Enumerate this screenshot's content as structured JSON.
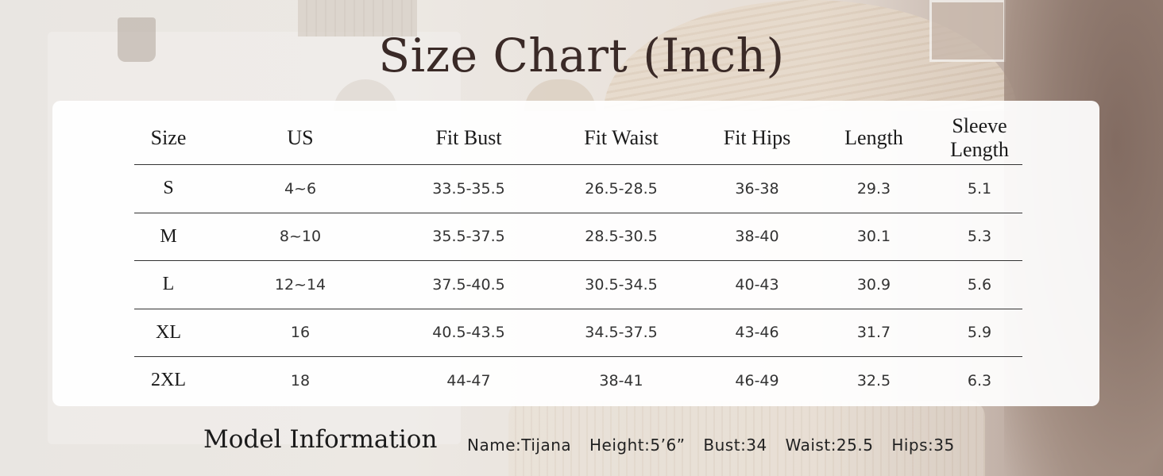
{
  "title": "Size Chart (Inch)",
  "table": {
    "headers": [
      "Size",
      "US",
      "Fit Bust",
      "Fit Waist",
      "Fit Hips",
      "Length",
      "Sleeve Length"
    ],
    "rows": [
      [
        "S",
        "4~6",
        "33.5-35.5",
        "26.5-28.5",
        "36-38",
        "29.3",
        "5.1"
      ],
      [
        "M",
        "8~10",
        "35.5-37.5",
        "28.5-30.5",
        "38-40",
        "30.1",
        "5.3"
      ],
      [
        "L",
        "12~14",
        "37.5-40.5",
        "30.5-34.5",
        "40-43",
        "30.9",
        "5.6"
      ],
      [
        "XL",
        "16",
        "40.5-43.5",
        "34.5-37.5",
        "43-46",
        "31.7",
        "5.9"
      ],
      [
        "2XL",
        "18",
        "44-47",
        "38-41",
        "46-49",
        "32.5",
        "6.3"
      ]
    ]
  },
  "model": {
    "heading": "Model Information",
    "name": "Name:Tijana",
    "height": "Height:5’6”",
    "bust": "Bust:34",
    "waist": "Waist:25.5",
    "hips": "Hips:35"
  }
}
